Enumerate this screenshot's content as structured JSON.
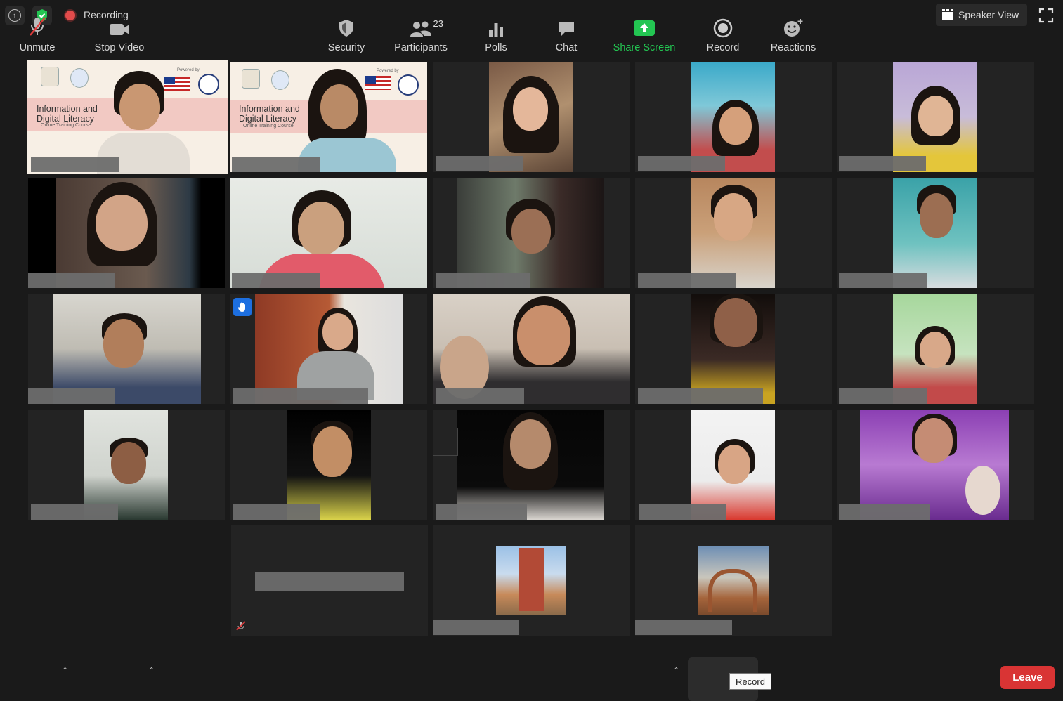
{
  "window": {
    "recording_label": "Recording",
    "speaker_view_label": "Speaker View"
  },
  "banner": {
    "powered_by": "Powered by",
    "title": "Information and Digital Literacy",
    "subtitle": "Online Training Course"
  },
  "toolbar": {
    "unmute": "Unmute",
    "stop_video": "Stop Video",
    "security": "Security",
    "participants": "Participants",
    "participants_count": "23",
    "polls": "Polls",
    "chat": "Chat",
    "share_screen": "Share Screen",
    "record": "Record",
    "record_tooltip": "Record",
    "reactions": "Reactions",
    "leave": "Leave"
  },
  "colors": {
    "active_speaker": "#e8ef6a",
    "share_green": "#23c552",
    "leave_red": "#d93434",
    "raise_hand_blue": "#1d6fe0"
  }
}
